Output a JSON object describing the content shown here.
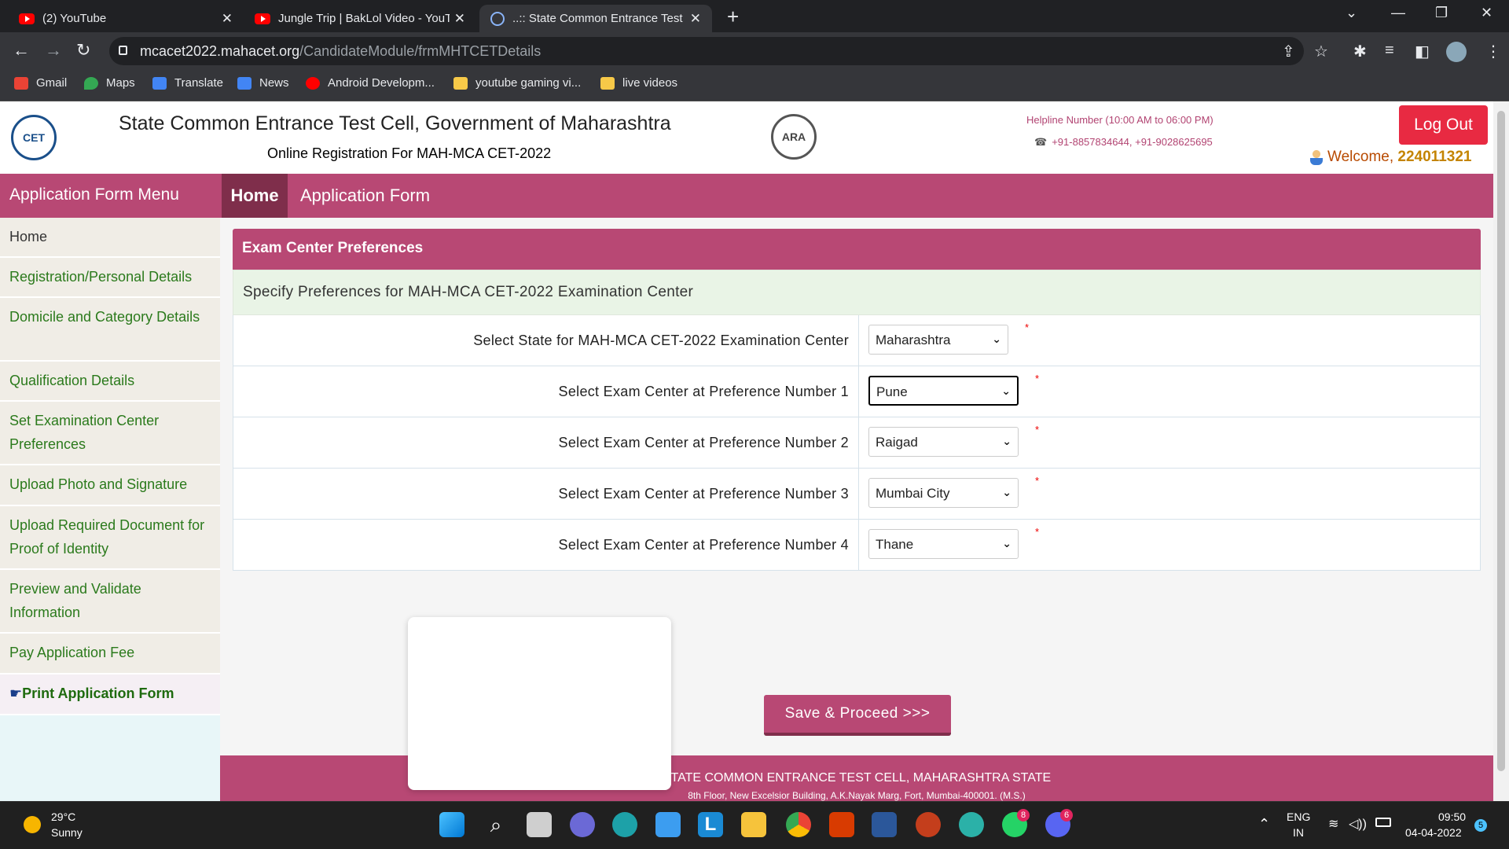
{
  "browser": {
    "tabs": [
      {
        "title": "(2) YouTube"
      },
      {
        "title": "Jungle Trip | BakLol Video - YouTu"
      },
      {
        "title": "..:: State Common Entrance Test C"
      }
    ],
    "url_host": "mcacet2022.mahacet.org",
    "url_path": "/CandidateModule/frmMHTCETDetails",
    "bookmarks": [
      "Gmail",
      "Maps",
      "Translate",
      "News",
      "Android Developm...",
      "youtube gaming vi...",
      "live videos"
    ]
  },
  "header": {
    "title": "State Common Entrance Test Cell, Government of Maharashtra",
    "subtitle": "Online Registration For MAH-MCA CET-2022",
    "helpline": "Helpline Number (10:00 AM to 06:00 PM)",
    "phones": "+91-8857834644, +91-9028625695",
    "logout": "Log Out",
    "welcome": "Welcome,",
    "user_id": "224011321",
    "logo_left": "CET",
    "logo_right": "ARA"
  },
  "menu": {
    "title": "Application Form Menu",
    "home": "Home",
    "application_form": "Application Form"
  },
  "sidebar": {
    "items": [
      "Home",
      "Registration/Personal Details",
      "Domicile and Category Details",
      "Qualification Details",
      "Set Examination Center Preferences",
      "Upload Photo and Signature",
      "Upload Required Document for Proof of Identity",
      "Preview and Validate Information",
      "Pay Application Fee",
      "Print Application Form"
    ]
  },
  "form": {
    "panel_title": "Exam Center Preferences",
    "spec": "Specify Preferences for MAH-MCA CET-2022 Examination Center",
    "rows": [
      {
        "label": "Select State for MAH-MCA CET-2022 Examination Center",
        "value": "Maharashtra"
      },
      {
        "label": "Select Exam Center at Preference Number 1",
        "value": "Pune"
      },
      {
        "label": "Select Exam Center at Preference Number 2",
        "value": "Raigad"
      },
      {
        "label": "Select Exam Center at Preference Number 3",
        "value": "Mumbai City"
      },
      {
        "label": "Select Exam Center at Preference Number 4",
        "value": "Thane"
      }
    ],
    "required_mark": "*",
    "save": "Save & Proceed >>>"
  },
  "footer": {
    "line1": "STATE COMMON ENTRANCE TEST CELL, MAHARASHTRA STATE",
    "line2": "8th Floor, New Excelsior Building, A.K.Nayak Marg, Fort, Mumbai-400001. (M.S.)"
  },
  "taskbar": {
    "temp": "29°C",
    "condition": "Sunny",
    "lang1": "ENG",
    "lang2": "IN",
    "time": "09:50",
    "date": "04-04-2022",
    "whatsapp_badge": "8",
    "discord_badge": "6",
    "notif_badge": "5"
  },
  "colors": {
    "brand": "#b84874",
    "brand_dark": "#7f2e4b",
    "logout": "#e82a42",
    "sidebar_link": "#2b7a1c"
  }
}
